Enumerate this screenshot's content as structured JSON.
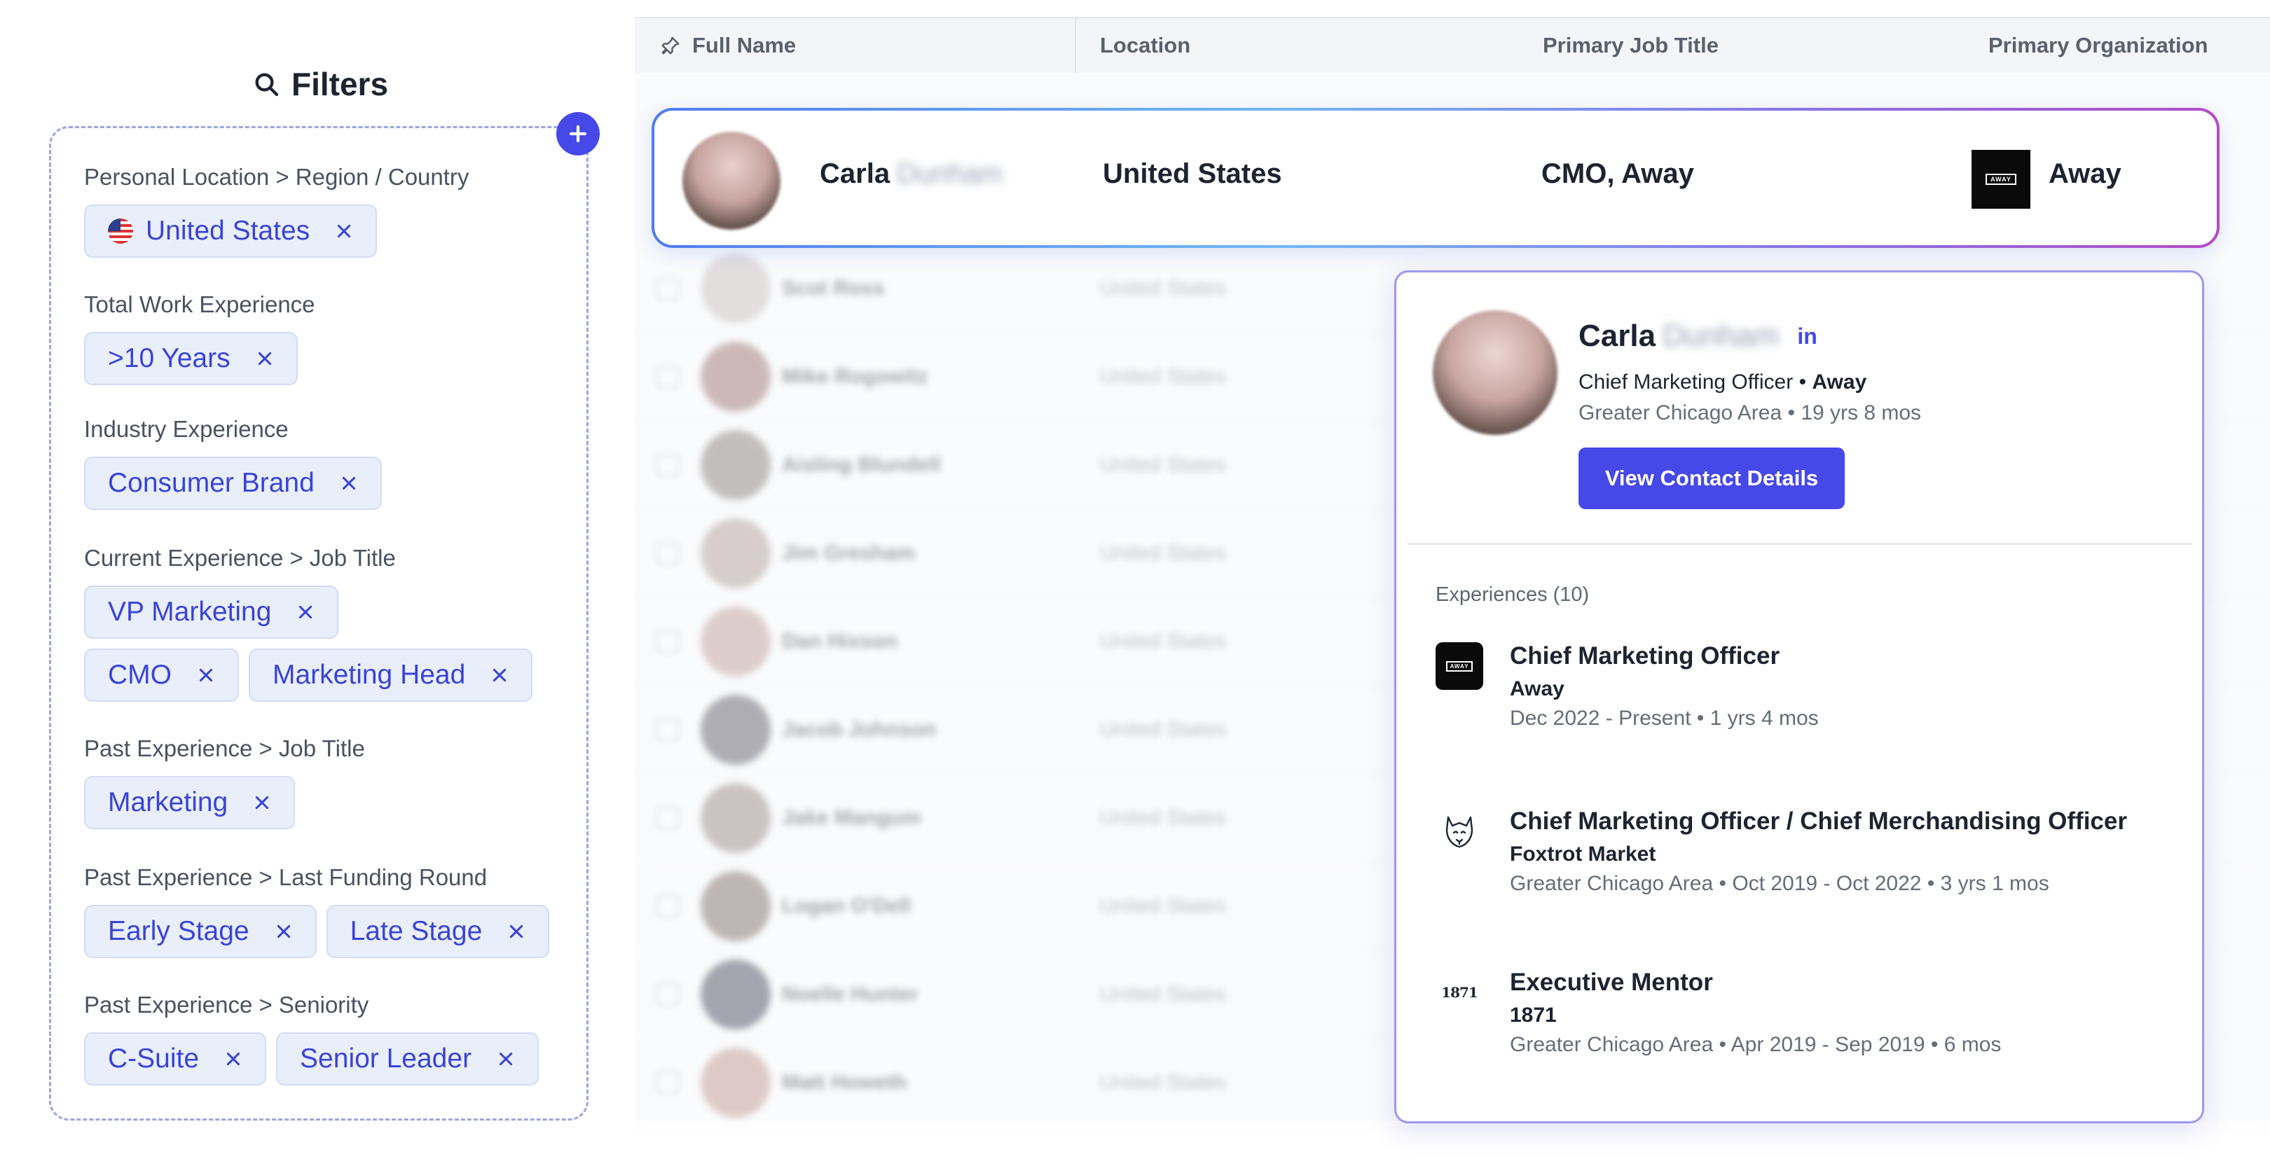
{
  "filters": {
    "title": "Filters",
    "groups": [
      {
        "label": "Personal Location > Region / Country",
        "chips": [
          "United States"
        ]
      },
      {
        "label": "Total Work Experience",
        "chips": [
          ">10 Years"
        ]
      },
      {
        "label": "Industry Experience",
        "chips": [
          "Consumer Brand"
        ]
      },
      {
        "label": "Current Experience > Job Title",
        "chips": [
          "VP Marketing",
          "CMO",
          "Marketing Head"
        ]
      },
      {
        "label": "Past Experience > Job Title",
        "chips": [
          "Marketing"
        ]
      },
      {
        "label": "Past Experience > Last Funding Round",
        "chips": [
          "Early Stage",
          "Late Stage"
        ]
      },
      {
        "label": "Past Experience > Seniority",
        "chips": [
          "C-Suite",
          "Senior Leader"
        ]
      }
    ]
  },
  "table": {
    "columns": [
      "Full Name",
      "Location",
      "Primary Job Title",
      "Primary Organization"
    ],
    "highlighted": {
      "first_name": "Carla",
      "last_name": "Dunham",
      "location": "United States",
      "job_title": "CMO, Away",
      "organization": "Away",
      "org_logo_text": "AWAY"
    },
    "rows": [
      {
        "name": "Scot Ross",
        "location": "United States"
      },
      {
        "name": "Mike Rogowitz",
        "location": "United States"
      },
      {
        "name": "Aisling Blundell",
        "location": "United States"
      },
      {
        "name": "Jim Gresham",
        "location": "United States"
      },
      {
        "name": "Dan Hixson",
        "location": "United States"
      },
      {
        "name": "Jacob Johnson",
        "location": "United States"
      },
      {
        "name": "Jake Mangum",
        "location": "United States"
      },
      {
        "name": "Logan O'Dell",
        "location": "United States"
      },
      {
        "name": "Noelle Hunter",
        "location": "United States"
      },
      {
        "name": "Matt Howeth",
        "location": "United States"
      }
    ]
  },
  "profile": {
    "first_name": "Carla",
    "last_name": "Dunham",
    "linkedin": "in",
    "role": "Chief Marketing Officer",
    "company": "Away",
    "meta": "Greater Chicago Area • 19 yrs 8 mos",
    "button_label": "View Contact Details",
    "experiences_heading": "Experiences (10)",
    "experiences": [
      {
        "title": "Chief Marketing Officer",
        "company": "Away",
        "dates": "Dec 2022 - Present • 1 yrs 4 mos",
        "logo": "away-logo",
        "logo_text": "AWAY"
      },
      {
        "title": "Chief Marketing Officer / Chief Merchandising Officer",
        "company": "Foxtrot Market",
        "dates": "Greater Chicago Area • Oct 2019 - Oct 2022 • 3 yrs 1 mos",
        "logo": "fox-logo"
      },
      {
        "title": "Executive Mentor",
        "company": "1871",
        "dates": "Greater Chicago Area • Apr 2019 - Sep 2019 • 6 mos",
        "logo": "1871-logo",
        "logo_text": "1871"
      }
    ]
  },
  "colors": {
    "accent": "#4648e8",
    "chip_bg": "#e9eefb",
    "chip_text": "#3a44d6"
  }
}
